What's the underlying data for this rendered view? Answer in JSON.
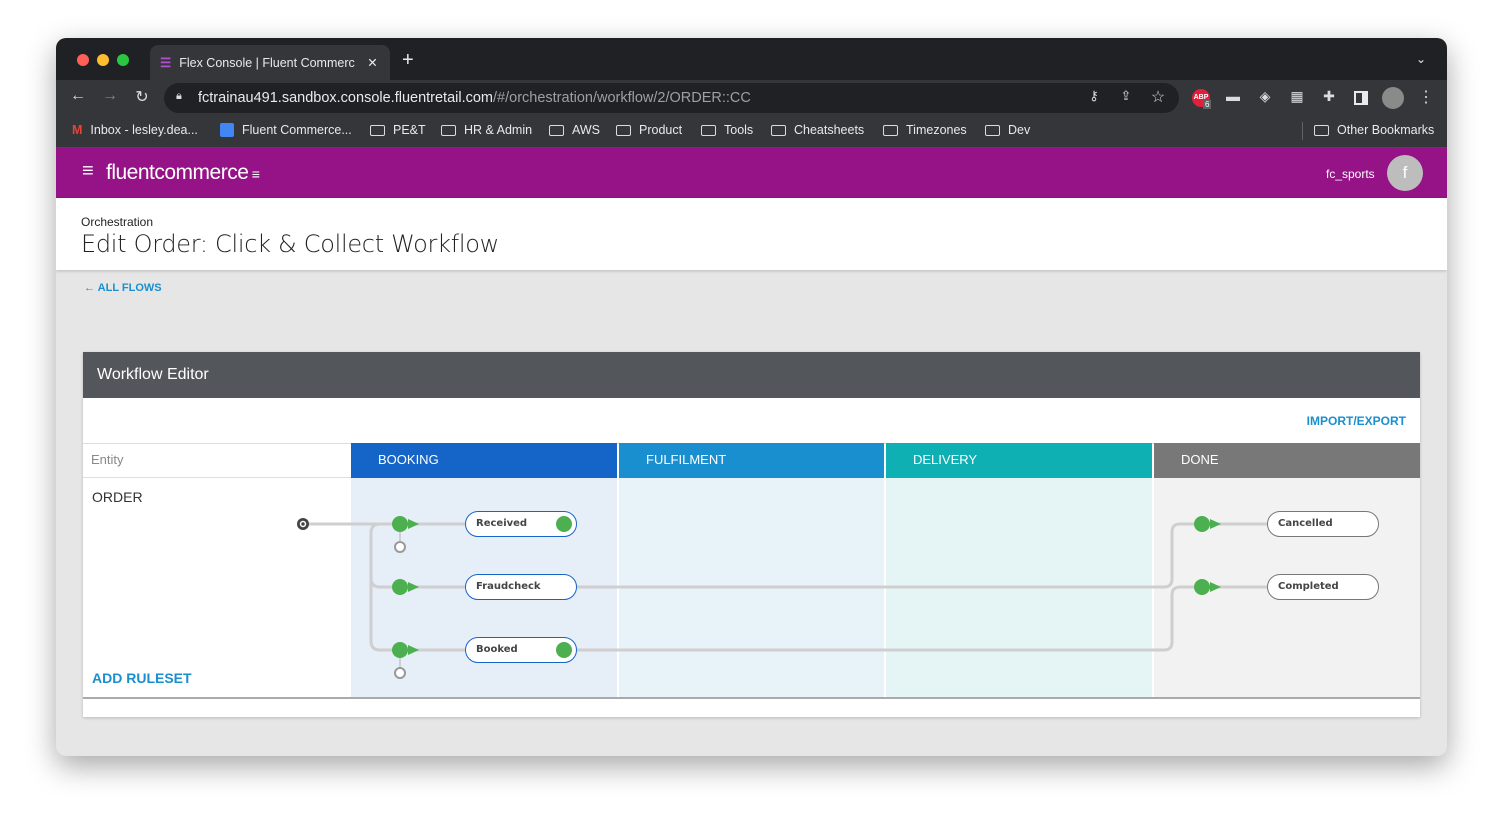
{
  "browser": {
    "tab_title": "Flex Console | Fluent Commerc",
    "url_host": "fctrainau491.sandbox.console.fluentretail.com",
    "url_path": "/#/orchestration/workflow/2/ORDER::CC",
    "extension_badge": "6",
    "bookmarks": [
      {
        "label": "Inbox - lesley.dea...",
        "icon": "gmail-icon"
      },
      {
        "label": "Fluent Commerce...",
        "icon": "calendar-icon"
      },
      {
        "label": "PE&T",
        "icon": "folder-icon"
      },
      {
        "label": "HR & Admin",
        "icon": "folder-icon"
      },
      {
        "label": "AWS",
        "icon": "folder-icon"
      },
      {
        "label": "Product",
        "icon": "folder-icon"
      },
      {
        "label": "Tools",
        "icon": "folder-icon"
      },
      {
        "label": "Cheatsheets",
        "icon": "folder-icon"
      },
      {
        "label": "Timezones",
        "icon": "folder-icon"
      },
      {
        "label": "Dev",
        "icon": "folder-icon"
      }
    ],
    "other_bookmarks": "Other Bookmarks"
  },
  "app": {
    "logo": "fluentcommerce",
    "username": "fc_sports",
    "avatar_letter": "f",
    "brand_color": "#951287"
  },
  "page": {
    "breadcrumb": "Orchestration",
    "title": "Edit Order: Click & Collect Workflow",
    "back_link": "ALL FLOWS"
  },
  "editor": {
    "title": "Workflow Editor",
    "import_export": "IMPORT/EXPORT",
    "entity_header": "Entity",
    "entity": "ORDER",
    "add_ruleset": "ADD RULESET",
    "lanes": [
      {
        "label": "BOOKING",
        "color": "#1565c8"
      },
      {
        "label": "FULFILMENT",
        "color": "#1a8fcf"
      },
      {
        "label": "DELIVERY",
        "color": "#0fb0b4"
      },
      {
        "label": "DONE",
        "color": "#787878"
      }
    ],
    "states": [
      "Received",
      "Fraudcheck",
      "Booked",
      "Cancelled",
      "Completed"
    ]
  }
}
